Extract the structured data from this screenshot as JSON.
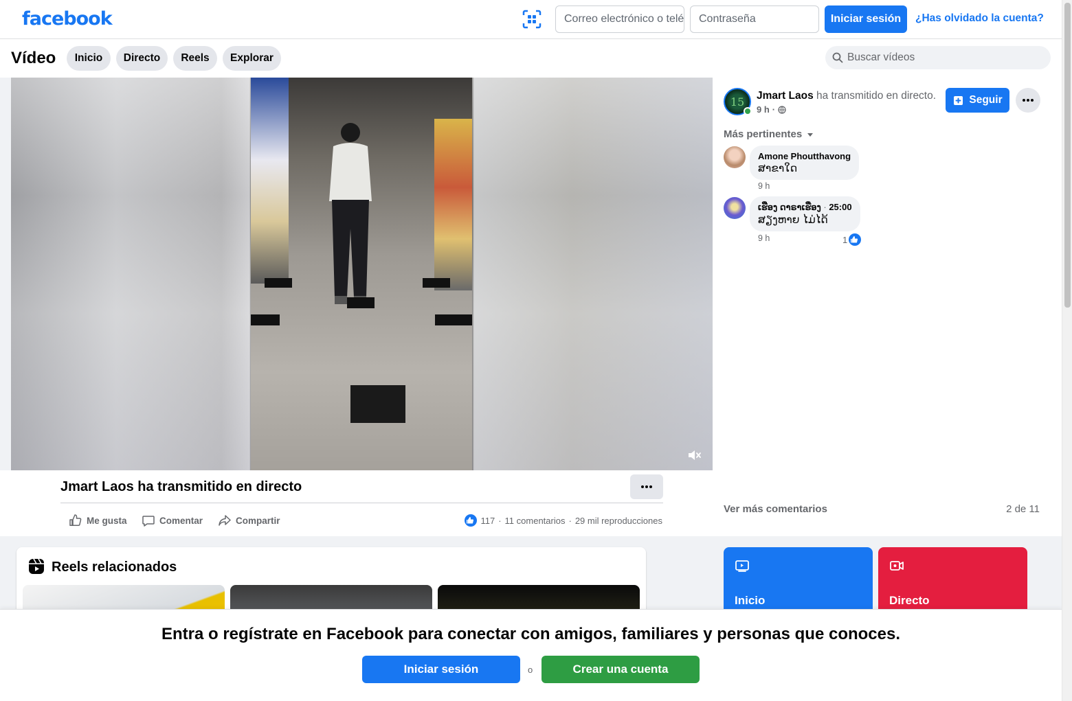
{
  "topbar": {
    "logo": "facebook",
    "email_placeholder": "Correo electrónico o teléfono",
    "password_placeholder": "Contraseña",
    "login_label": "Iniciar sesión",
    "forgot_label": "¿Has olvidado la cuenta?"
  },
  "subheader": {
    "title": "Vídeo",
    "tabs": [
      {
        "label": "Inicio"
      },
      {
        "label": "Directo"
      },
      {
        "label": "Reels"
      },
      {
        "label": "Explorar"
      }
    ],
    "search_placeholder": "Buscar vídeos"
  },
  "video": {
    "caption": "Jmart Laos ha transmitido en directo",
    "muted": true
  },
  "actions": {
    "like": "Me gusta",
    "comment": "Comentar",
    "share": "Compartir"
  },
  "stats": {
    "likes": "117",
    "comments": "11 comentarios",
    "views": "29 mil reproducciones"
  },
  "post": {
    "page_name": "Jmart Laos",
    "action_text": " ha transmitido en directo.",
    "time": "9 h",
    "follow_label": "Seguir"
  },
  "comments": {
    "sort_label": "Más pertinentes",
    "items": [
      {
        "author": "Amone Phoutthavong",
        "text": "ສາຂາໃດ",
        "time": "9 h",
        "likes": ""
      },
      {
        "author": "ເຮືອງ ດາຣາເຮືອງ",
        "timestamp": "25:00",
        "text": "ສຽງຫາຍ ໄມ່ໄດ້",
        "time": "9 h",
        "likes": "1"
      }
    ],
    "see_more": "Ver más comentarios",
    "count": "2 de 11"
  },
  "reels": {
    "title": "Reels relacionados"
  },
  "nav_cards": [
    {
      "label": "Inicio",
      "color": "#1877f2"
    },
    {
      "label": "Directo",
      "color": "#e41e3f"
    }
  ],
  "banner": {
    "text": "Entra o regístrate en Facebook para conectar con amigos, familiares y personas que conoces.",
    "login_label": "Iniciar sesión",
    "or_label": "o",
    "create_label": "Crear una cuenta"
  },
  "colors": {
    "brand": "#1877f2",
    "create_green": "#2e9d43",
    "live_red": "#e41e3f"
  }
}
